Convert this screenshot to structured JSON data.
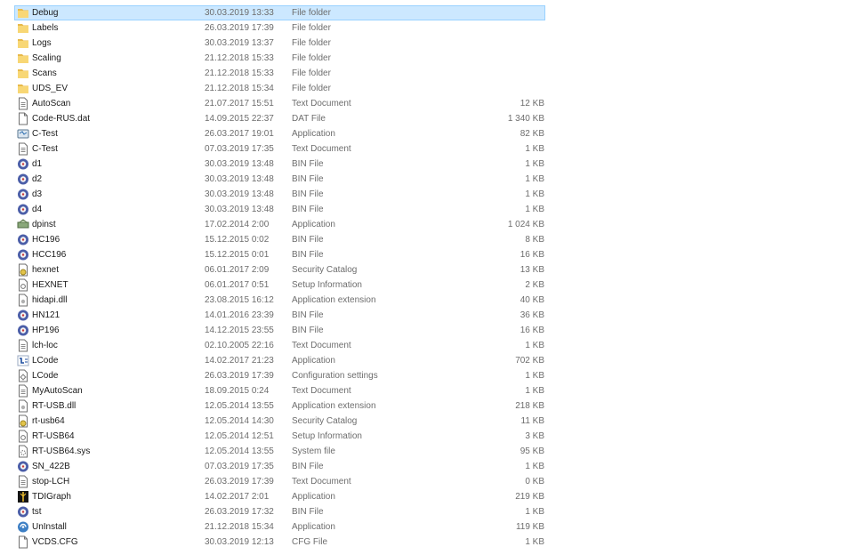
{
  "files": [
    {
      "name": "Debug",
      "date": "30.03.2019 13:33",
      "type": "File folder",
      "size": "",
      "icon": "folder-icon"
    },
    {
      "name": "Labels",
      "date": "26.03.2019 17:39",
      "type": "File folder",
      "size": "",
      "icon": "folder-icon"
    },
    {
      "name": "Logs",
      "date": "30.03.2019 13:37",
      "type": "File folder",
      "size": "",
      "icon": "folder-icon"
    },
    {
      "name": "Scaling",
      "date": "21.12.2018 15:33",
      "type": "File folder",
      "size": "",
      "icon": "folder-icon"
    },
    {
      "name": "Scans",
      "date": "21.12.2018 15:33",
      "type": "File folder",
      "size": "",
      "icon": "folder-icon"
    },
    {
      "name": "UDS_EV",
      "date": "21.12.2018 15:34",
      "type": "File folder",
      "size": "",
      "icon": "folder-icon"
    },
    {
      "name": "AutoScan",
      "date": "21.07.2017 15:51",
      "type": "Text Document",
      "size": "12 KB",
      "icon": "text-document-icon"
    },
    {
      "name": "Code-RUS.dat",
      "date": "14.09.2015 22:37",
      "type": "DAT File",
      "size": "1 340 KB",
      "icon": "blank-file-icon"
    },
    {
      "name": "C-Test",
      "date": "26.03.2017 19:01",
      "type": "Application",
      "size": "82 KB",
      "icon": "application-icon"
    },
    {
      "name": "C-Test",
      "date": "07.03.2019 17:35",
      "type": "Text Document",
      "size": "1 KB",
      "icon": "text-document-icon"
    },
    {
      "name": "d1",
      "date": "30.03.2019 13:48",
      "type": "BIN File",
      "size": "1 KB",
      "icon": "bin-file-icon"
    },
    {
      "name": "d2",
      "date": "30.03.2019 13:48",
      "type": "BIN File",
      "size": "1 KB",
      "icon": "bin-file-icon"
    },
    {
      "name": "d3",
      "date": "30.03.2019 13:48",
      "type": "BIN File",
      "size": "1 KB",
      "icon": "bin-file-icon"
    },
    {
      "name": "d4",
      "date": "30.03.2019 13:48",
      "type": "BIN File",
      "size": "1 KB",
      "icon": "bin-file-icon"
    },
    {
      "name": "dpinst",
      "date": "17.02.2014 2:00",
      "type": "Application",
      "size": "1 024 KB",
      "icon": "installer-icon"
    },
    {
      "name": "HC196",
      "date": "15.12.2015 0:02",
      "type": "BIN File",
      "size": "8 KB",
      "icon": "bin-file-icon"
    },
    {
      "name": "HCC196",
      "date": "15.12.2015 0:01",
      "type": "BIN File",
      "size": "16 KB",
      "icon": "bin-file-icon"
    },
    {
      "name": "hexnet",
      "date": "06.01.2017 2:09",
      "type": "Security Catalog",
      "size": "13 KB",
      "icon": "security-catalog-icon"
    },
    {
      "name": "HEXNET",
      "date": "06.01.2017 0:51",
      "type": "Setup Information",
      "size": "2 KB",
      "icon": "setup-information-icon"
    },
    {
      "name": "hidapi.dll",
      "date": "23.08.2015 16:12",
      "type": "Application extension",
      "size": "40 KB",
      "icon": "dll-file-icon"
    },
    {
      "name": "HN121",
      "date": "14.01.2016 23:39",
      "type": "BIN File",
      "size": "36 KB",
      "icon": "bin-file-icon"
    },
    {
      "name": "HP196",
      "date": "14.12.2015 23:55",
      "type": "BIN File",
      "size": "16 KB",
      "icon": "bin-file-icon"
    },
    {
      "name": "lch-loc",
      "date": "02.10.2005 22:16",
      "type": "Text Document",
      "size": "1 KB",
      "icon": "text-document-icon"
    },
    {
      "name": "LCode",
      "date": "14.02.2017 21:23",
      "type": "Application",
      "size": "702 KB",
      "icon": "lcode-application-icon"
    },
    {
      "name": "LCode",
      "date": "26.03.2019 17:39",
      "type": "Configuration settings",
      "size": "1 KB",
      "icon": "config-settings-icon"
    },
    {
      "name": "MyAutoScan",
      "date": "18.09.2015 0:24",
      "type": "Text Document",
      "size": "1 KB",
      "icon": "text-document-icon"
    },
    {
      "name": "RT-USB.dll",
      "date": "12.05.2014 13:55",
      "type": "Application extension",
      "size": "218 KB",
      "icon": "dll-file-icon"
    },
    {
      "name": "rt-usb64",
      "date": "12.05.2014 14:30",
      "type": "Security Catalog",
      "size": "11 KB",
      "icon": "security-catalog-icon"
    },
    {
      "name": "RT-USB64",
      "date": "12.05.2014 12:51",
      "type": "Setup Information",
      "size": "3 KB",
      "icon": "setup-information-icon"
    },
    {
      "name": "RT-USB64.sys",
      "date": "12.05.2014 13:55",
      "type": "System file",
      "size": "95 KB",
      "icon": "system-file-icon"
    },
    {
      "name": "SN_422B",
      "date": "07.03.2019 17:35",
      "type": "BIN File",
      "size": "1 KB",
      "icon": "bin-file-icon"
    },
    {
      "name": "stop-LCH",
      "date": "26.03.2019 17:39",
      "type": "Text Document",
      "size": "0 KB",
      "icon": "text-document-icon"
    },
    {
      "name": "TDIGraph",
      "date": "14.02.2017 2:01",
      "type": "Application",
      "size": "219 KB",
      "icon": "tdigraph-application-icon"
    },
    {
      "name": "tst",
      "date": "26.03.2019 17:32",
      "type": "BIN File",
      "size": "1 KB",
      "icon": "bin-file-icon"
    },
    {
      "name": "UnInstall",
      "date": "21.12.2018 15:34",
      "type": "Application",
      "size": "119 KB",
      "icon": "uninstall-application-icon"
    },
    {
      "name": "VCDS.CFG",
      "date": "30.03.2019 12:13",
      "type": "CFG File",
      "size": "1 KB",
      "icon": "blank-file-icon"
    }
  ],
  "selected_row": 0,
  "colors": {
    "selection_bg": "#cce8ff",
    "selection_border": "#99d1ff",
    "folder": "#f8d775",
    "secondary_text": "#6d6d6d"
  }
}
